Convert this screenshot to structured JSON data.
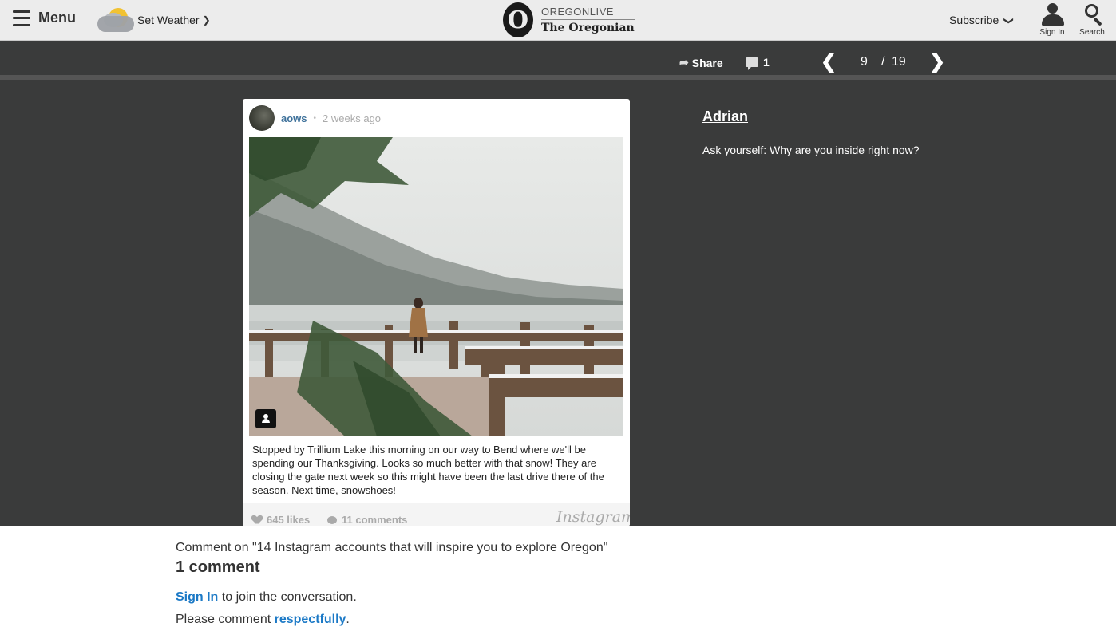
{
  "header": {
    "menu_label": "Menu",
    "weather_label": "Set Weather",
    "logo_initial": "O",
    "logo_line1": "OREGONLIVE",
    "logo_line2": "The Oregonian",
    "subscribe_label": "Subscribe",
    "signin_label": "Sign In",
    "search_label": "Search"
  },
  "gallery_bar": {
    "share_label": "Share",
    "comment_count": "1",
    "prev_icon": "❮",
    "next_icon": "❯",
    "current_page": "9",
    "separator": "/",
    "total_pages": "19"
  },
  "post": {
    "username": "aows",
    "dot": "•",
    "time_ago": "2 weeks ago",
    "caption": "Stopped by Trillium Lake this morning on our way to Bend where we'll be spending our Thanksgiving. Looks so much better with that snow! They are closing the gate next week so this might have been the last drive there of the season. Next time, snowshoes!",
    "likes": "645 likes",
    "comments": "11 comments",
    "brand": "Instagram"
  },
  "description": {
    "title": "Adrian",
    "text": "Ask yourself: Why are you inside right now?"
  },
  "comments_section": {
    "title": "Comment on \"14 Instagram accounts that will inspire you to explore Oregon\"",
    "count": "1 comment",
    "signin_link": "Sign In",
    "join_text": " to join the conversation.",
    "respect_prefix": "Please comment ",
    "respect_link": "respectfully",
    "respect_suffix": "."
  },
  "colors": {
    "header_bg": "#ececec",
    "page_bg": "#3a3b3b",
    "link_blue": "#1b79c6",
    "instagram_user": "#3f729b"
  }
}
